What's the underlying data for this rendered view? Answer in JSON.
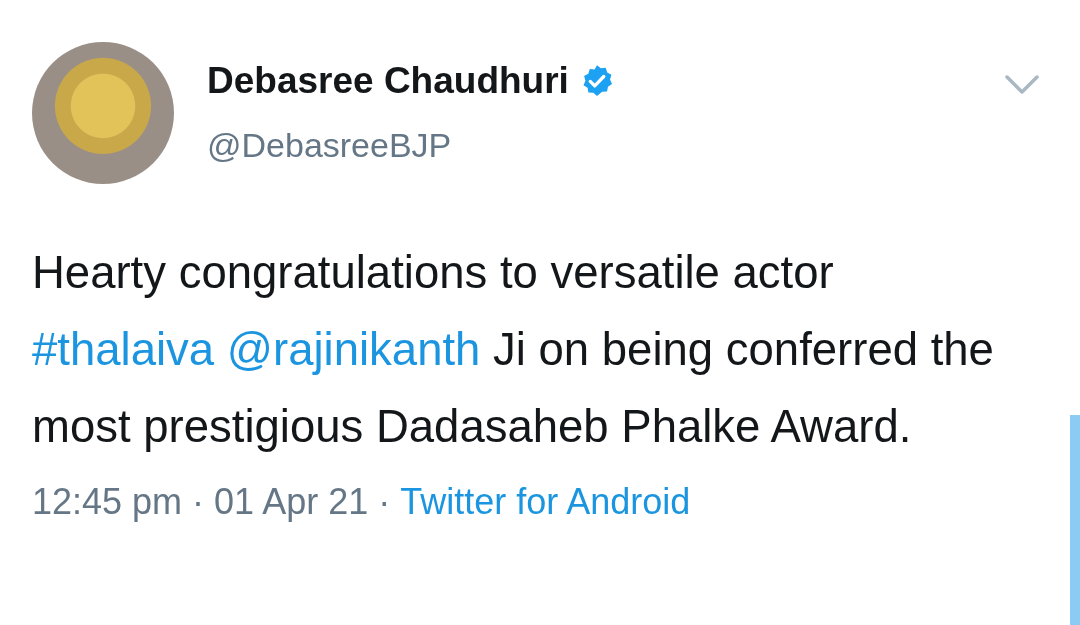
{
  "author": {
    "name": "Debasree Chaudhuri",
    "verified": true,
    "handle": "@DebasreeBJP"
  },
  "body": [
    {
      "kind": "text",
      "text": "Hearty congratulations to versatile actor"
    },
    {
      "kind": "hashtag",
      "text": "#thalaiva"
    },
    {
      "kind": "mention",
      "text": "@rajinikanth"
    },
    {
      "kind": "text",
      "text": "Ji on being conferred the most prestigious Dadasaheb Phalke Award."
    }
  ],
  "meta": [
    {
      "kind": "text",
      "text": "12:45 pm · 01 Apr 21 · "
    },
    {
      "kind": "link",
      "text": "Twitter for Android"
    }
  ]
}
